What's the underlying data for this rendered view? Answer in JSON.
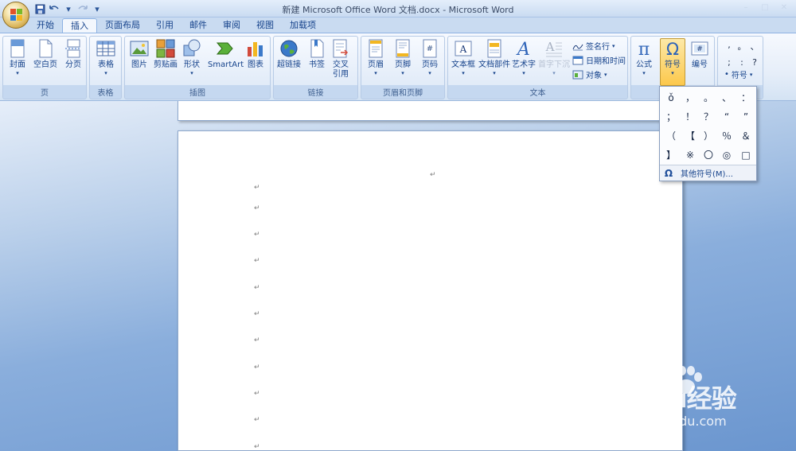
{
  "window": {
    "title": "新建 Microsoft Office Word 文档.docx - Microsoft Word",
    "controls": [
      "–",
      "□",
      "✕"
    ]
  },
  "qat": {
    "save_icon": "save-icon",
    "undo_icon": "undo-icon",
    "redo_icon": "redo-icon",
    "customize": "▾"
  },
  "tabs": [
    {
      "label": "开始",
      "active": false
    },
    {
      "label": "插入",
      "active": true
    },
    {
      "label": "页面布局",
      "active": false
    },
    {
      "label": "引用",
      "active": false
    },
    {
      "label": "邮件",
      "active": false
    },
    {
      "label": "审阅",
      "active": false
    },
    {
      "label": "视图",
      "active": false
    },
    {
      "label": "加载项",
      "active": false
    }
  ],
  "ribbon": {
    "groups": {
      "page": "页",
      "table": "表格",
      "illustrations": "插图",
      "links": "链接",
      "header_footer": "页眉和页脚",
      "text": "文本"
    },
    "buttons": {
      "cover": "封面",
      "blank_page": "空白页",
      "page_break": "分页",
      "table": "表格",
      "picture": "图片",
      "clipart": "剪贴画",
      "shapes": "形状",
      "smartart": "SmartArt",
      "chart": "图表",
      "hyperlink": "超链接",
      "bookmark": "书签",
      "cross_ref_1": "交叉",
      "cross_ref_2": "引用",
      "header": "页眉",
      "footer": "页脚",
      "page_number": "页码",
      "textbox": "文本框",
      "quick_parts": "文档部件",
      "wordart": "艺术字",
      "dropcap": "首字下沉",
      "signature": "签名行",
      "datetime": "日期和时间",
      "object": "对象",
      "equation": "公式",
      "symbol": "符号",
      "number": "编号",
      "special_symbol": "符号"
    },
    "special_symbols": [
      ",",
      "。",
      "、",
      ";",
      ":",
      "?"
    ],
    "special_bullet": "•"
  },
  "symbol_menu": {
    "symbols": [
      "ǒ",
      "，",
      "。",
      "、",
      "：",
      "；",
      "！",
      "？",
      "“",
      "”",
      "（",
      "【",
      "）",
      "％",
      "＆",
      "】",
      "※",
      "〇",
      "◎",
      "□"
    ],
    "more_label": "其他符号(M)..."
  },
  "document": {
    "para_mark": "↵"
  },
  "watermark": {
    "main": "Baidu经验",
    "sub": "jingyan.baidu.com"
  },
  "colors": {
    "accent": "#15428b",
    "active_button": "#fcc84c",
    "workspace": "#8aaedc"
  }
}
